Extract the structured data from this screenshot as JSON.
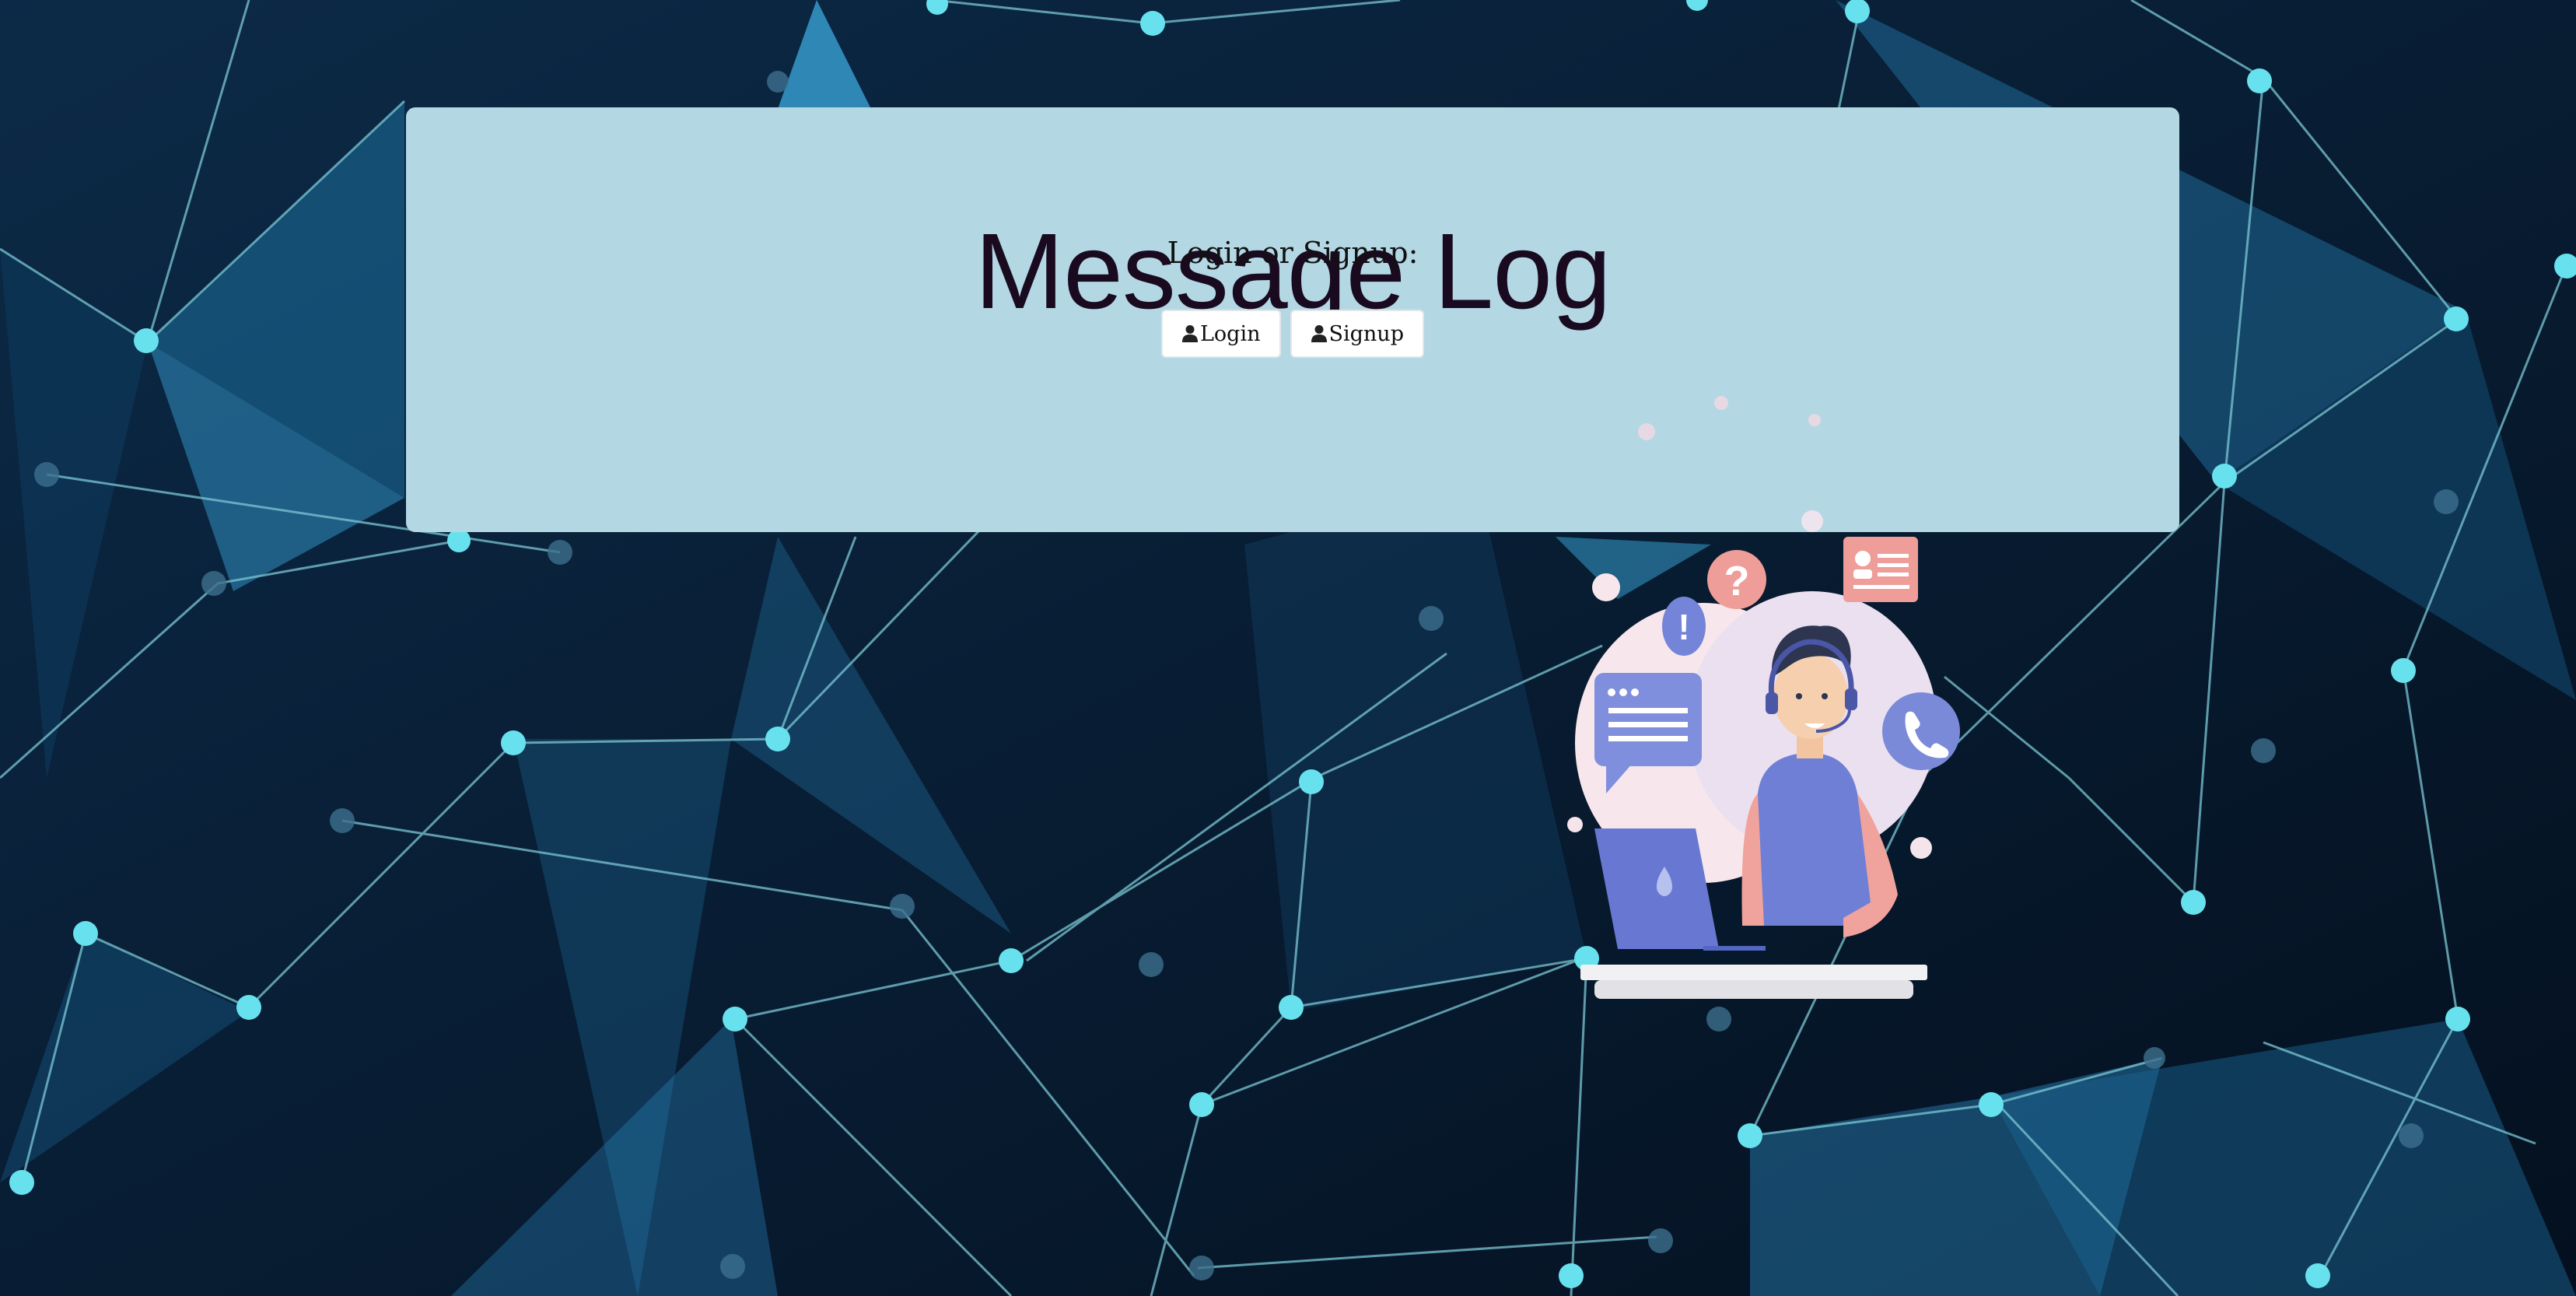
{
  "page": {
    "title": "Message Log",
    "subtitle": "Login or Signup:"
  },
  "buttons": {
    "login_label": "Login",
    "signup_label": "Signup"
  },
  "icons": {
    "login": "user-icon",
    "signup": "user-icon"
  },
  "colors": {
    "jumbotron": "#b4d7e4",
    "title": "#1a0a20",
    "background": "#071526",
    "network_node": "#67e1ee"
  }
}
